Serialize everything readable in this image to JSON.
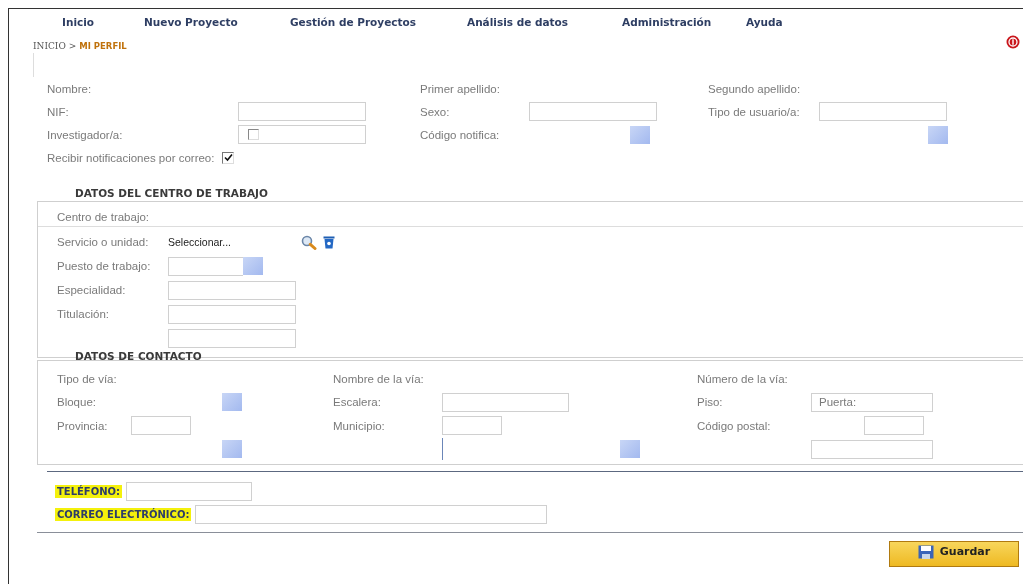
{
  "nav": [
    {
      "label": "Inicio"
    },
    {
      "label": "Nuevo Proyecto"
    },
    {
      "label": "Gestión de Proyectos"
    },
    {
      "label": "Análisis de datos"
    },
    {
      "label": "Administración"
    },
    {
      "label": "Ayuda"
    }
  ],
  "breadcrumb": {
    "parent": "INICIO >",
    "current": "MI PERFIL"
  },
  "personal": [
    {
      "groups": [
        {
          "label": "Nombre:"
        },
        {
          "label": "Primer apellido:"
        },
        {
          "label": "Segundo apellido:"
        }
      ]
    },
    {
      "groups": [
        {
          "label": "NIF:",
          "controls": [
            {
              "kind": "field"
            }
          ]
        },
        {
          "label": "Sexo:",
          "controls": [
            {
              "kind": "field"
            }
          ]
        },
        {
          "label": "Tipo de usuario/a:",
          "controls": [
            {
              "kind": "field"
            }
          ]
        }
      ]
    },
    {
      "groups": [
        {
          "label": "Investigador/a:",
          "controls": [
            {
              "kind": "checkfield",
              "checked": false
            }
          ]
        },
        {
          "label": "Código notifica:",
          "controls": [
            {
              "kind": "picker"
            }
          ]
        },
        {
          "controls": [
            {
              "kind": "picker"
            }
          ]
        }
      ]
    },
    {
      "groups": [
        {
          "label": "Recibir notificaciones por correo:",
          "controls": [
            {
              "kind": "checkbox",
              "checked": true
            }
          ]
        }
      ]
    }
  ],
  "work": {
    "title": "DATOS DEL CENTRO DE TRABAJO",
    "centre_label": "Centro de trabajo:",
    "rows": [
      {
        "label": "Servicio o unidad:",
        "controls": [
          {
            "kind": "select",
            "text": "Seleccionar..."
          },
          {
            "kind": "search"
          },
          {
            "kind": "trash"
          }
        ]
      },
      {
        "label": "Puesto de trabajo:",
        "controls": [
          {
            "kind": "short"
          },
          {
            "kind": "picker"
          }
        ]
      },
      {
        "label": "Especialidad:",
        "controls": [
          {
            "kind": "field"
          }
        ]
      },
      {
        "label": "Titulación:",
        "controls": [
          {
            "kind": "field"
          }
        ]
      },
      {
        "controls": [
          {
            "kind": "field"
          }
        ]
      }
    ]
  },
  "contact": {
    "title": "DATOS DE CONTACTO",
    "rows": [
      {
        "groups": [
          {
            "label": "Tipo de vía:"
          },
          {
            "label": "Nombre de la vía:"
          },
          {
            "label": "Número de la vía:"
          }
        ]
      },
      {
        "groups": [
          {
            "label": "Bloque:",
            "controls": [
              {
                "kind": "picker"
              }
            ]
          },
          {
            "label": "Escalera:",
            "controls": [
              {
                "kind": "field"
              }
            ]
          },
          {
            "label": "Piso:",
            "controls": [
              {
                "kind": "field",
                "text": "Puerta:"
              }
            ]
          }
        ]
      },
      {
        "groups": [
          {
            "label": "Provincia:",
            "controls": [
              {
                "kind": "short"
              }
            ]
          },
          {
            "label": "Municipio:",
            "controls": [
              {
                "kind": "short"
              }
            ]
          },
          {
            "label": "Código postal:",
            "controls": [
              {
                "kind": "gap"
              },
              {
                "kind": "short"
              }
            ]
          }
        ]
      },
      {
        "groups": [
          {
            "controls": [
              {
                "kind": "picker"
              }
            ]
          },
          {
            "controls": [
              {
                "kind": "edge"
              },
              {
                "kind": "picker"
              }
            ]
          },
          {
            "controls": [
              {
                "kind": "field"
              }
            ]
          }
        ]
      }
    ]
  },
  "phone": {
    "label": "TELÉFONO:"
  },
  "email": {
    "label": "CORREO ELECTRÓNICO:"
  },
  "save_button": {
    "label": "Guardar"
  }
}
